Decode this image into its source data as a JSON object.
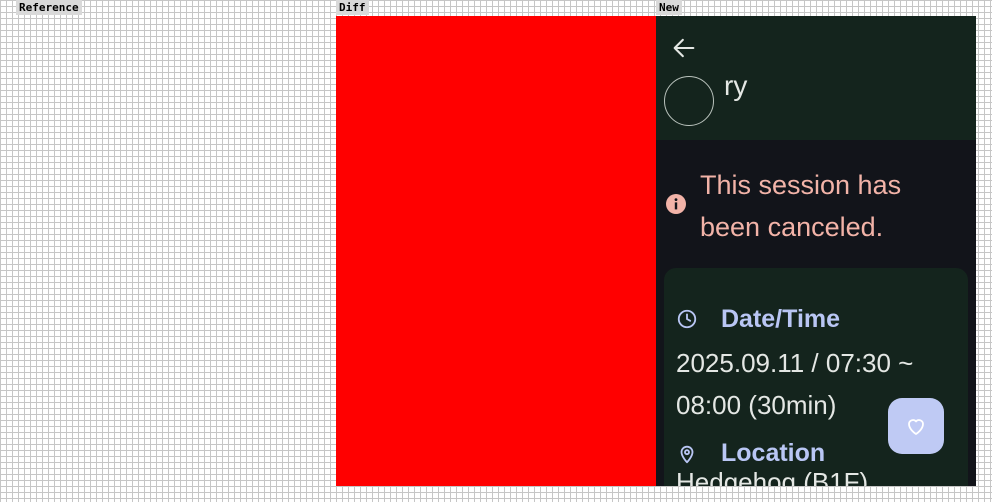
{
  "labels": {
    "reference": "Reference",
    "diff": "Diff",
    "new": "New"
  },
  "colors": {
    "diff_fill": "#ff0000",
    "app_background": "#12141a",
    "top_bar": "#14241d",
    "card_background": "#14241d",
    "cancel_text": "#f2b3a8",
    "section_label": "#b9c6f4",
    "fab_background": "#bfcaf4"
  },
  "app": {
    "back_icon": "arrow-left-icon",
    "title_fragment": "ry",
    "cancel_notice": {
      "icon": "info-icon",
      "text": "This session has been canceled."
    },
    "details": {
      "date_time": {
        "icon": "clock-icon",
        "label": "Date/Time",
        "value": "2025.09.11 / 07:30 ~ 08:00 (30min)"
      },
      "location": {
        "icon": "location-pin-icon",
        "label": "Location",
        "value": "Hedgehog (B1F)"
      }
    },
    "favorite_icon": "heart-outline-icon"
  }
}
